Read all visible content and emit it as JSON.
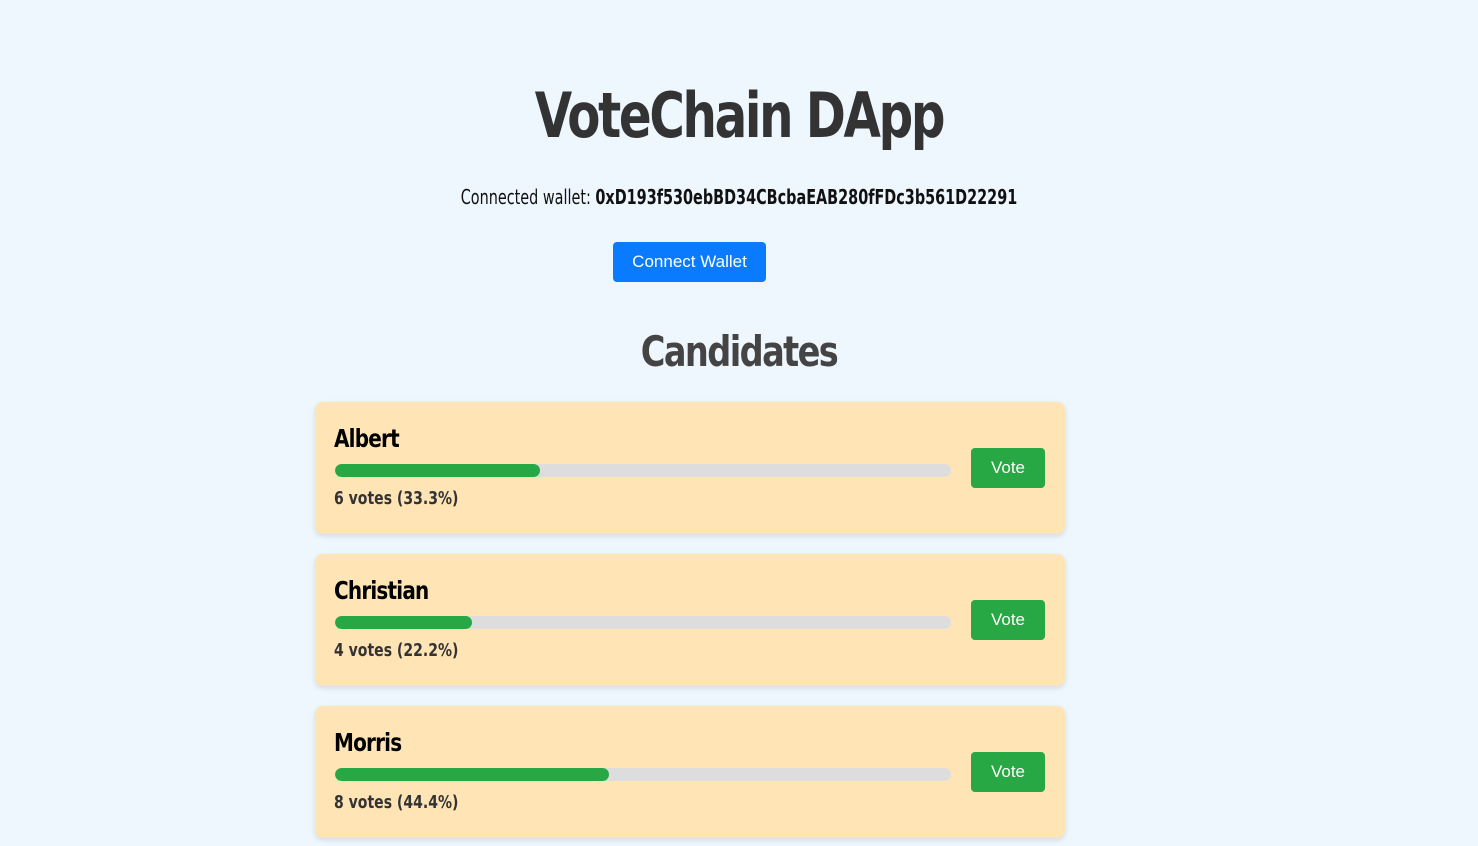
{
  "header": {
    "title": "VoteChain DApp",
    "wallet_label": "Connected wallet:",
    "wallet_address": "0xD193f530ebBD34CBcbaEAB280fFDc3b561D22291",
    "connect_button": "Connect Wallet"
  },
  "candidates_section": {
    "title": "Candidates",
    "items": [
      {
        "name": "Albert",
        "votes_text": "6 votes (33.3%)",
        "votes": 6,
        "percent": 33.3,
        "vote_button": "Vote"
      },
      {
        "name": "Christian",
        "votes_text": "4 votes (22.2%)",
        "votes": 4,
        "percent": 22.2,
        "vote_button": "Vote"
      },
      {
        "name": "Morris",
        "votes_text": "8 votes (44.4%)",
        "votes": 8,
        "percent": 44.4,
        "vote_button": "Vote"
      }
    ]
  },
  "colors": {
    "background": "#eef6fe",
    "primary_button": "#0a7bff",
    "vote_button": "#28a745",
    "progress_fill": "#28a745",
    "progress_track": "#dddddd",
    "card_background": "#ffe4b5"
  }
}
